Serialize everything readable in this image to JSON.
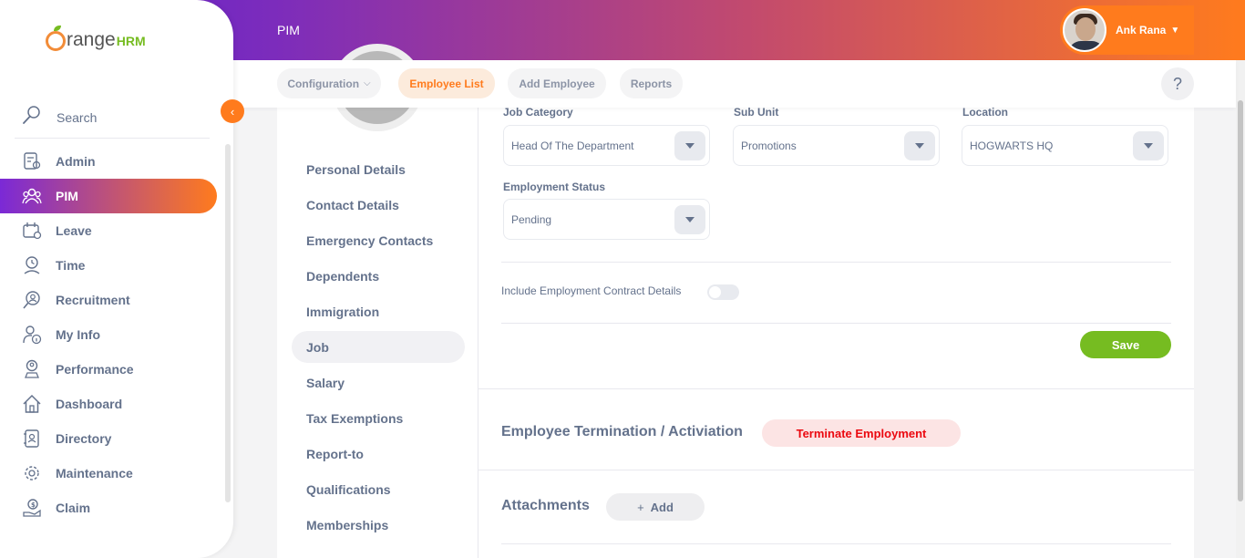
{
  "topbar": {
    "module_title": "PIM",
    "user_name": "Ank Rana"
  },
  "sidebar": {
    "logo_main": "range",
    "logo_suffix": "HRM",
    "search_label": "Search",
    "items": [
      {
        "label": "Admin",
        "icon": "admin-icon"
      },
      {
        "label": "PIM",
        "icon": "pim-icon"
      },
      {
        "label": "Leave",
        "icon": "leave-icon"
      },
      {
        "label": "Time",
        "icon": "time-icon"
      },
      {
        "label": "Recruitment",
        "icon": "recruitment-icon"
      },
      {
        "label": "My Info",
        "icon": "my-info-icon"
      },
      {
        "label": "Performance",
        "icon": "performance-icon"
      },
      {
        "label": "Dashboard",
        "icon": "dashboard-icon"
      },
      {
        "label": "Directory",
        "icon": "directory-icon"
      },
      {
        "label": "Maintenance",
        "icon": "maintenance-icon"
      },
      {
        "label": "Claim",
        "icon": "claim-icon"
      }
    ],
    "active_item": "PIM"
  },
  "subnav": {
    "tabs": [
      {
        "label": "Configuration"
      },
      {
        "label": "Employee List"
      },
      {
        "label": "Add Employee"
      },
      {
        "label": "Reports"
      }
    ],
    "active_tab": "Employee List",
    "help_label": "?"
  },
  "employee_nav": {
    "items": [
      {
        "label": "Personal Details"
      },
      {
        "label": "Contact Details"
      },
      {
        "label": "Emergency Contacts"
      },
      {
        "label": "Dependents"
      },
      {
        "label": "Immigration"
      },
      {
        "label": "Job"
      },
      {
        "label": "Salary"
      },
      {
        "label": "Tax Exemptions"
      },
      {
        "label": "Report-to"
      },
      {
        "label": "Qualifications"
      },
      {
        "label": "Memberships"
      }
    ],
    "active_item": "Job"
  },
  "job_form": {
    "job_category": {
      "label": "Job Category",
      "value": "Head Of The Department"
    },
    "sub_unit": {
      "label": "Sub Unit",
      "value": "Promotions"
    },
    "location": {
      "label": "Location",
      "value": "HOGWARTS HQ"
    },
    "employment_status": {
      "label": "Employment Status",
      "value": "Pending"
    },
    "contract_toggle_label": "Include Employment Contract Details",
    "contract_toggle_on": false,
    "save_label": "Save"
  },
  "termination": {
    "title": "Employee Termination / Activiation",
    "button_label": "Terminate Employment"
  },
  "attachments": {
    "title": "Attachments",
    "add_label": "Add",
    "add_icon": "plus-icon"
  },
  "colors": {
    "accent": "#ff7b1d",
    "brand_purple": "#5b1fd0",
    "save_green": "#76bc21",
    "danger_red": "#eb0910"
  }
}
